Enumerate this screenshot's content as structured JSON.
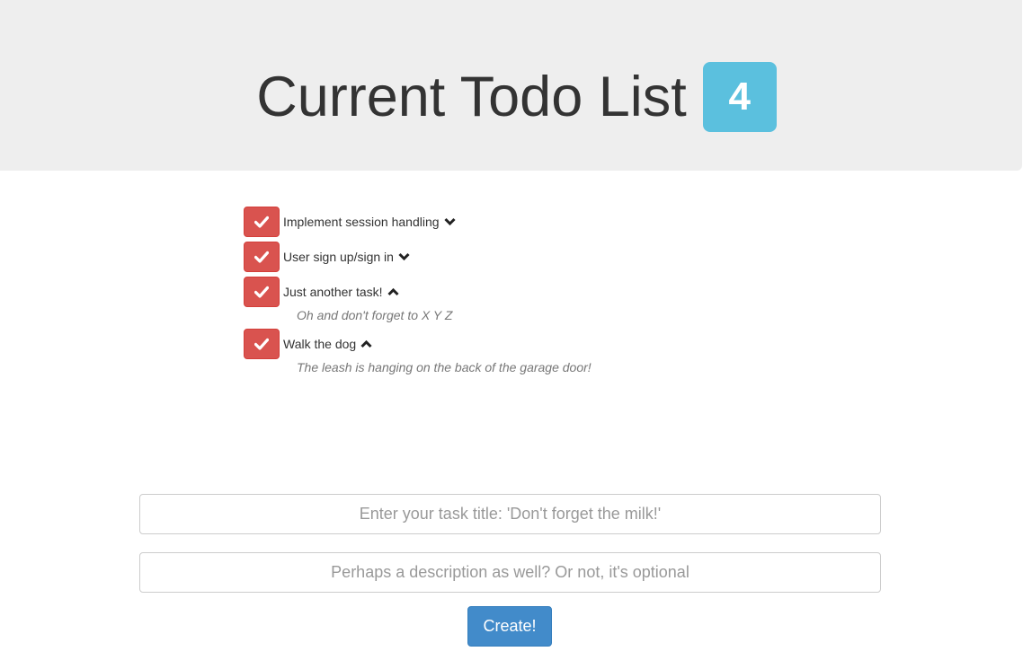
{
  "header": {
    "title": "Current Todo List",
    "count_badge": "4"
  },
  "todos": [
    {
      "title": "Implement session handling",
      "expanded": false,
      "description": ""
    },
    {
      "title": "User sign up/sign in",
      "expanded": false,
      "description": ""
    },
    {
      "title": "Just another task!",
      "expanded": true,
      "description": "Oh and don't forget to X Y Z"
    },
    {
      "title": "Walk the dog",
      "expanded": true,
      "description": "The leash is hanging on the back of the garage door!"
    }
  ],
  "form": {
    "title_placeholder": "Enter your task title: 'Don't forget the milk!'",
    "title_value": "",
    "description_placeholder": "Perhaps a description as well? Or not, it's optional",
    "description_value": "",
    "create_label": "Create!"
  },
  "colors": {
    "badge": "#5bc0de",
    "check_button": "#d9534f",
    "create_button": "#428bca",
    "jumbotron": "#eeeeee"
  },
  "icons": {
    "check": "check-icon",
    "collapsed": "chevron-down-icon",
    "expanded": "chevron-up-icon"
  }
}
